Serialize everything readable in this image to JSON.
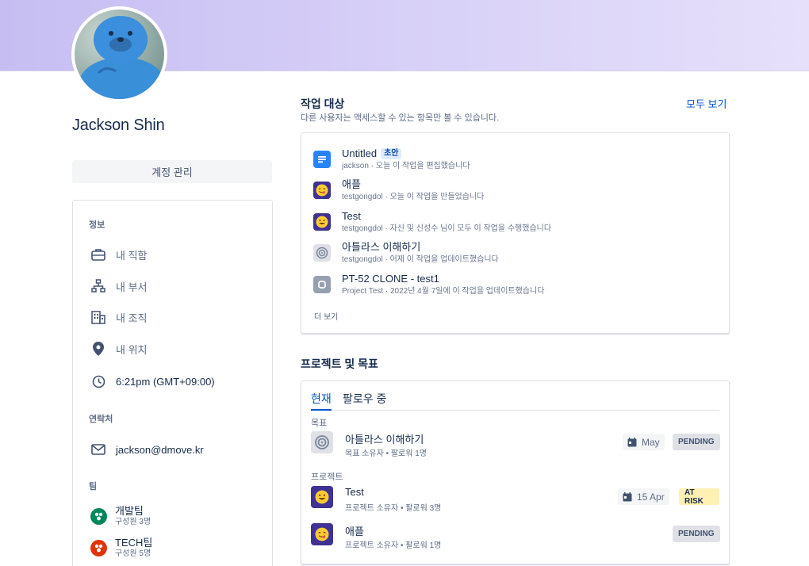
{
  "profile": {
    "name": "Jackson Shin",
    "account_button": "계정 관리"
  },
  "info": {
    "section_label": "정보",
    "job": "내 직함",
    "department": "내 부서",
    "organization": "내 조직",
    "location": "내 위치",
    "time": "6:21pm (GMT+09:00)",
    "contact_label": "연락처",
    "email": "jackson@dmove.kr",
    "team_label": "팀",
    "teams": [
      {
        "name": "개발팀",
        "members": "구성원 3명",
        "color": "#00875a"
      },
      {
        "name": "TECH팀",
        "members": "구성원 5명",
        "color": "#de350b"
      }
    ]
  },
  "work": {
    "title": "작업 대상",
    "subtitle": "다른 사용자는 액세스할 수 있는 항목만 볼 수 있습니다.",
    "see_all": "모두 보기",
    "more": "더 보기",
    "items": [
      {
        "title": "Untitled",
        "badge": "초안",
        "meta": "jackson · 오늘 이 작업을 편집했습니다",
        "icon": "document-icon"
      },
      {
        "title": "애플",
        "meta": "testgongdol · 오늘 이 작업을 만들었습니다",
        "icon": "yum-emoji-icon"
      },
      {
        "title": "Test",
        "meta": "testgongdol · 자신 및 신성수 님이 모두 이 작업을 수행했습니다",
        "icon": "smile-emoji-icon"
      },
      {
        "title": "아틀라스 이해하기",
        "meta": "testgongdol · 어제 이 작업을 업데이트했습니다",
        "icon": "goal-target-icon"
      },
      {
        "title": "PT-52 CLONE - test1",
        "meta": "Project Test · 2022년 4월 7일에 이 작업을 업데이트했습니다",
        "icon": "project-icon"
      }
    ]
  },
  "projects": {
    "title": "프로젝트 및 목표",
    "tabs": [
      "현재",
      "팔로우 중"
    ],
    "goals_label": "목표",
    "projects_label": "프로젝트",
    "goal": {
      "title": "아틀라스 이해하기",
      "meta": "목표 소유자 • 팔로워 1명",
      "date": "May",
      "status": "PENDING"
    },
    "items": [
      {
        "title": "Test",
        "meta": "프로젝트 소유자 • 팔로워 3명",
        "date": "15 Apr",
        "status": "AT RISK"
      },
      {
        "title": "애플",
        "meta": "프로젝트 소유자 • 팔로워 1명",
        "date": "",
        "status": "PENDING"
      }
    ]
  }
}
